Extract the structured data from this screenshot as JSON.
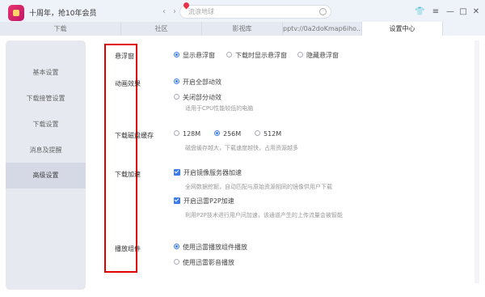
{
  "titlebar": {
    "promo": "十周年，抢10年会员",
    "back_icon": "chevron-left-icon",
    "forward_icon": "chevron-right-icon",
    "search_placeholder": "流浪地球",
    "window_icons": [
      "skin-icon",
      "menu-icon",
      "minimize-icon",
      "maximize-icon",
      "close-icon"
    ]
  },
  "tabs": [
    {
      "label": "下载",
      "active": false
    },
    {
      "label": "社区",
      "active": false
    },
    {
      "label": "影视库",
      "active": false
    },
    {
      "label": "pptv://0a2doKmap6iho...",
      "active": false
    },
    {
      "label": "设置中心",
      "active": true
    }
  ],
  "sidebar": {
    "items": [
      {
        "label": "基本设置"
      },
      {
        "label": "下载接管设置"
      },
      {
        "label": "下载设置"
      },
      {
        "label": "消息及提醒"
      },
      {
        "label": "高级设置",
        "active": true
      }
    ]
  },
  "settings": {
    "floating": {
      "label": "悬浮窗",
      "options": [
        "显示悬浮窗",
        "下载时显示悬浮窗",
        "隐藏悬浮窗"
      ]
    },
    "animation": {
      "label": "动画效果",
      "opt_on": "开启全部动效",
      "opt_off": "关闭部分动效",
      "hint": "适用于CPU性能较低的电脑"
    },
    "disk_cache": {
      "label": "下载磁盘缓存",
      "options": [
        "128M",
        "256M",
        "512M"
      ],
      "hint": "磁盘缓存越大，下载速度越快，占用资源越多"
    },
    "speedup": {
      "label": "下载加速",
      "mirror": "开启镜像服务器加速",
      "mirror_hint": "全网数据挖掘，自动匹配与原始资源相同的镜像供用户下载",
      "p2p": "开启迅雷P2P加速",
      "p2p_hint": "利用P2P技术进行用户间加速，该通道产生的上传流量会被智能"
    },
    "player": {
      "label": "播放组件",
      "opt1": "使用迅雷播放组件播放",
      "opt2": "使用迅雷影音播放"
    }
  },
  "colors": {
    "accent": "#3a7bf0",
    "highlight_box": "#e00000"
  }
}
